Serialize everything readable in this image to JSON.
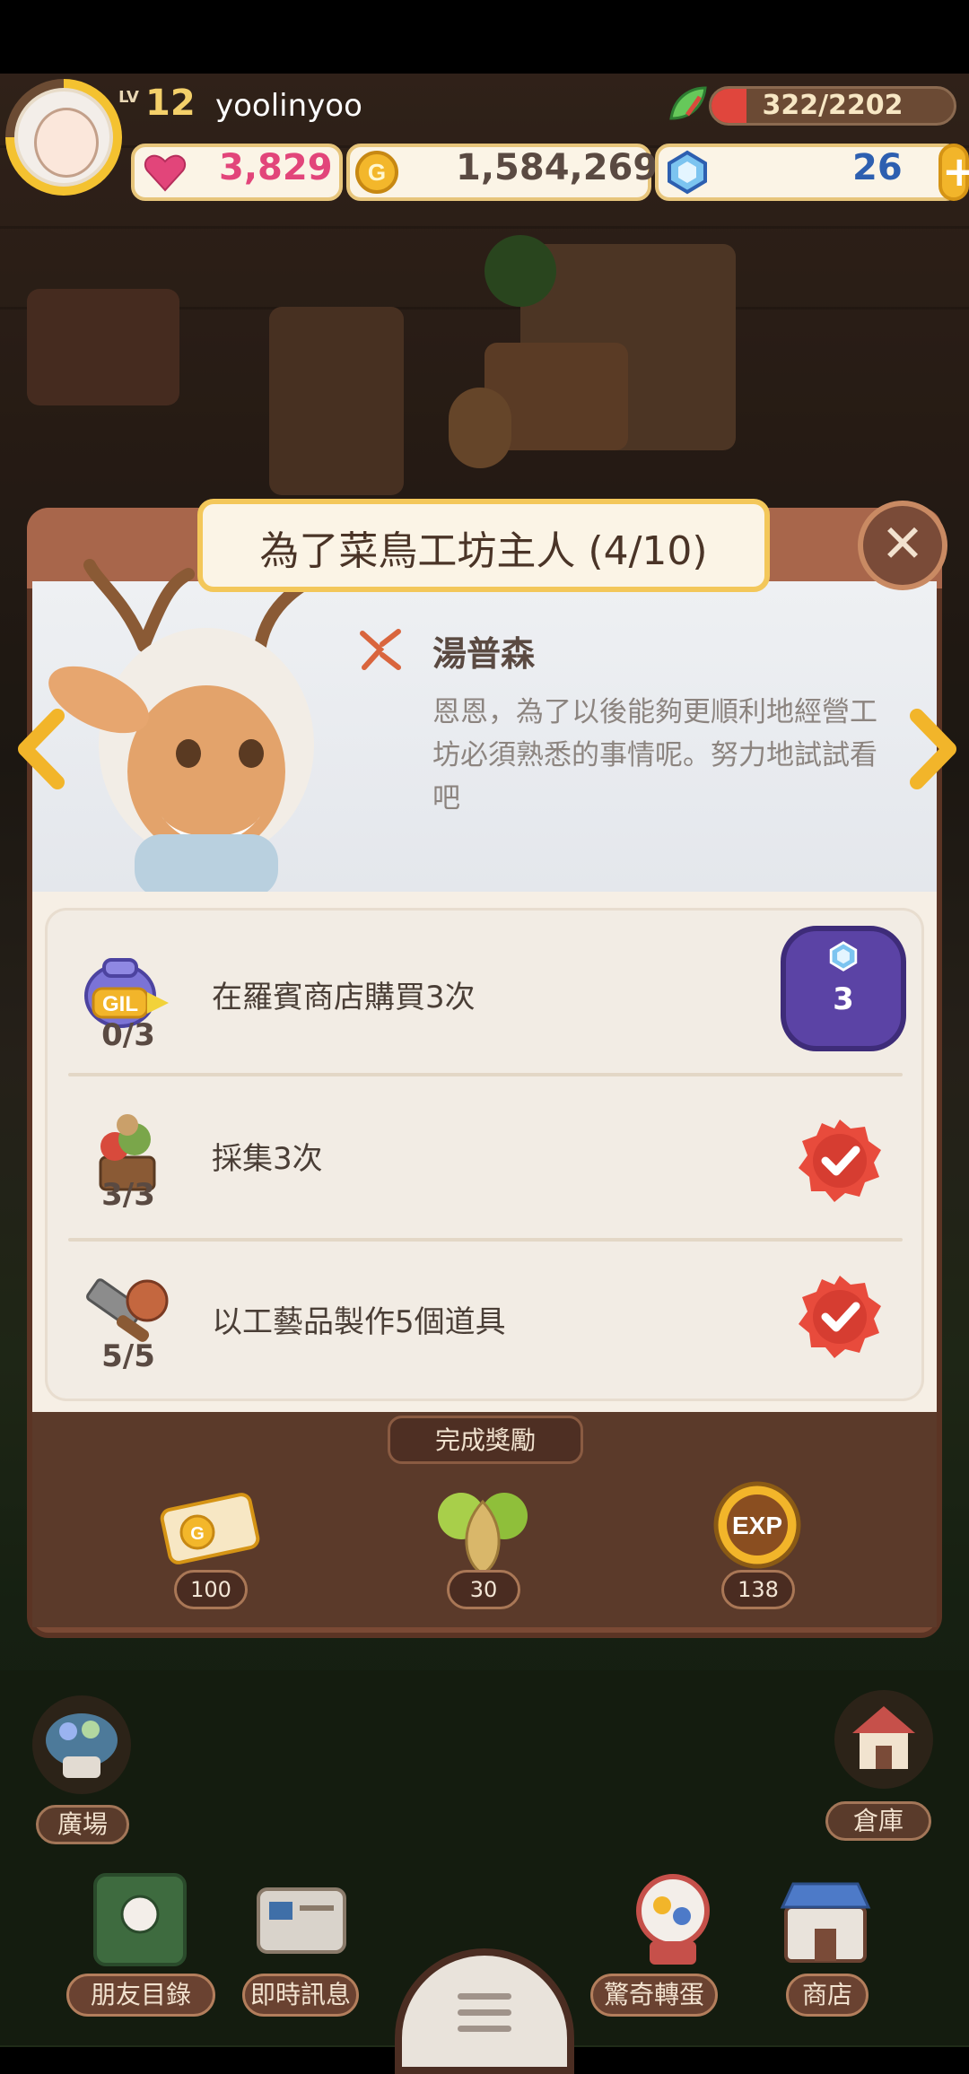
{
  "hud": {
    "level_label": "LV",
    "level": "12",
    "username": "yoolinyoo",
    "energy_text": "322/2202",
    "energy_fraction": 0.146,
    "hearts": "3,829",
    "gold": "1,584,269",
    "gems": "26",
    "plus": "+"
  },
  "dialog": {
    "title": "為了菜鳥工坊主人 (4/10)",
    "close": "✕",
    "speaker": "湯普森",
    "speech": "恩恩，為了以後能夠更順利地經營工坊必須熟悉的事情呢。努力地試試看吧"
  },
  "missions": [
    {
      "icon": "gil-bag-icon",
      "progress": "0/3",
      "text": "在羅賓商店購買3次",
      "status": "reward"
    },
    {
      "icon": "gathering-icon",
      "progress": "3/3",
      "text": "採集3次",
      "status": "done"
    },
    {
      "icon": "crafting-icon",
      "progress": "5/5",
      "text": "以工藝品製作5個道具",
      "status": "done"
    }
  ],
  "mission_reward": {
    "icon": "gem-icon",
    "amount": "3"
  },
  "completion_rewards": {
    "title": "完成獎勵",
    "items": [
      {
        "icon": "gold-ticket-icon",
        "amount": "100"
      },
      {
        "icon": "onion-icon",
        "amount": "30"
      },
      {
        "icon": "exp-icon",
        "amount": "138"
      }
    ]
  },
  "nav": {
    "plaza": "廣場",
    "warehouse": "倉庫",
    "friends": "朋友目錄",
    "messages": "即時訊息",
    "gacha": "驚奇轉蛋",
    "shop": "商店"
  },
  "colors": {
    "heart": "#e2457a",
    "gold": "#5a4a42",
    "gem": "#2d5fb0",
    "accent_purple": "#5b43a5",
    "check_red": "#e84b3c"
  }
}
